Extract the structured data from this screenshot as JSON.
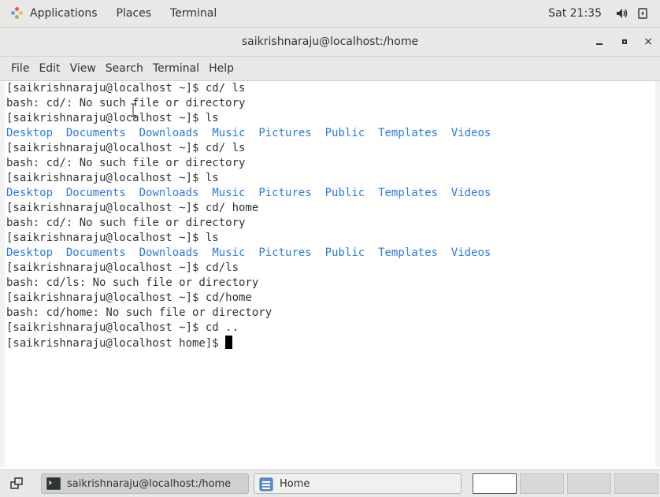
{
  "top_panel": {
    "menus": [
      "Applications",
      "Places",
      "Terminal"
    ],
    "clock": "Sat 21:35",
    "icons": [
      "applications-icon",
      "volume-icon",
      "power-icon"
    ]
  },
  "window": {
    "title": "saikrishnaraju@localhost:/home",
    "controls": {
      "minimize": "minimize",
      "maximize": "maximize",
      "close": "×"
    }
  },
  "menubar": {
    "items": [
      "File",
      "Edit",
      "View",
      "Search",
      "Terminal",
      "Help"
    ]
  },
  "terminal": {
    "lines": [
      {
        "type": "text",
        "text": "[saikrishnaraju@localhost ~]$ cd/ ls"
      },
      {
        "type": "text",
        "text": "bash: cd/: No such file or directory"
      },
      {
        "type": "text",
        "text": "[saikrishnaraju@localhost ~]$ ls"
      },
      {
        "type": "dirs",
        "items": [
          "Desktop",
          "Documents",
          "Downloads",
          "Music",
          "Pictures",
          "Public",
          "Templates",
          "Videos"
        ]
      },
      {
        "type": "text",
        "text": "[saikrishnaraju@localhost ~]$ cd/ ls"
      },
      {
        "type": "text",
        "text": "bash: cd/: No such file or directory"
      },
      {
        "type": "text",
        "text": "[saikrishnaraju@localhost ~]$ ls"
      },
      {
        "type": "dirs",
        "items": [
          "Desktop",
          "Documents",
          "Downloads",
          "Music",
          "Pictures",
          "Public",
          "Templates",
          "Videos"
        ]
      },
      {
        "type": "text",
        "text": "[saikrishnaraju@localhost ~]$ cd/ home"
      },
      {
        "type": "text",
        "text": "bash: cd/: No such file or directory"
      },
      {
        "type": "text",
        "text": "[saikrishnaraju@localhost ~]$ ls"
      },
      {
        "type": "dirs",
        "items": [
          "Desktop",
          "Documents",
          "Downloads",
          "Music",
          "Pictures",
          "Public",
          "Templates",
          "Videos"
        ]
      },
      {
        "type": "text",
        "text": "[saikrishnaraju@localhost ~]$ cd/ls"
      },
      {
        "type": "text",
        "text": "bash: cd/ls: No such file or directory"
      },
      {
        "type": "text",
        "text": "[saikrishnaraju@localhost ~]$ cd/home"
      },
      {
        "type": "text",
        "text": "bash: cd/home: No such file or directory"
      },
      {
        "type": "text",
        "text": "[saikrishnaraju@localhost ~]$ cd .."
      },
      {
        "type": "prompt",
        "text": "[saikrishnaraju@localhost home]$ "
      }
    ],
    "dir_color": "#2a7bde",
    "text_color": "#2e3436"
  },
  "taskbar": {
    "tasks": [
      {
        "label": "saikrishnaraju@localhost:/home",
        "icon": "terminal-icon",
        "active": true
      },
      {
        "label": "Home",
        "icon": "file-manager-icon",
        "active": false
      }
    ],
    "workspaces": 4,
    "current_workspace": 1
  }
}
